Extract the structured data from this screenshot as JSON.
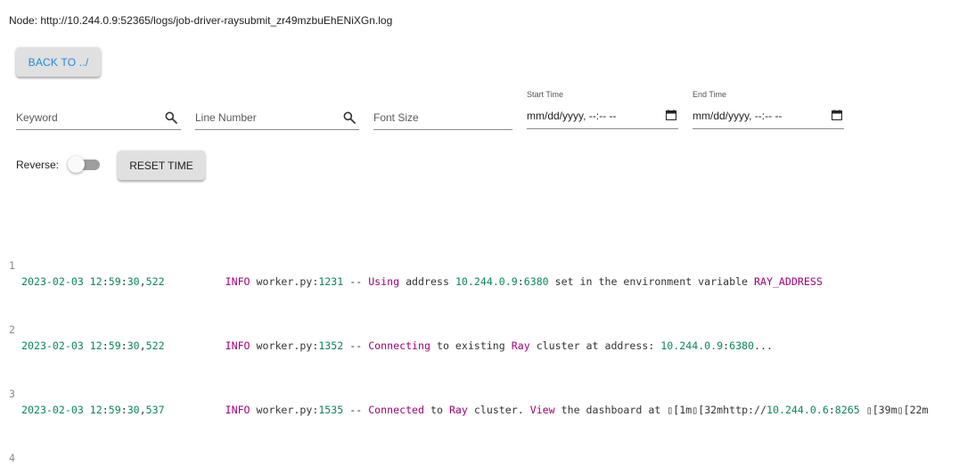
{
  "node": {
    "title": "Node: http://10.244.0.9:52365/logs/job-driver-raysubmit_zr49mzbuEhENiXGn.log"
  },
  "buttons": {
    "back_label": "BACK TO ../",
    "reset_label": "RESET TIME"
  },
  "filters": {
    "keyword_placeholder": "Keyword",
    "line_number_placeholder": "Line Number",
    "font_size_placeholder": "Font Size",
    "start_time_label": "Start Time",
    "start_time_value": "mm/dd/yyyy, --:-- --",
    "end_time_label": "End Time",
    "end_time_value": "mm/dd/yyyy, --:-- --"
  },
  "reverse": {
    "label": "Reverse:",
    "checked": false
  },
  "log": {
    "lines": [
      {
        "n": "1",
        "date": "2023-02-03",
        "t1": "12",
        "t2": "59",
        "t3": "30",
        "ms": "522",
        "level": "INFO",
        "file": "worker.py",
        "lineno": "1231",
        "sep": "--",
        "verb": "Using",
        "mid": "address",
        "ip": "10.244.0.9",
        "port": "6380",
        "rest": "set in the environment variable",
        "tail": "RAY_ADDRESS"
      },
      {
        "n": "2",
        "date": "2023-02-03",
        "t1": "12",
        "t2": "59",
        "t3": "30",
        "ms": "522",
        "level": "INFO",
        "file": "worker.py",
        "lineno": "1352",
        "sep": "--",
        "verb": "Connecting",
        "mid": "to existing",
        "ray": "Ray",
        "rest": "cluster at address:",
        "ip": "10.244.0.9",
        "port": "6380",
        "tail": "..."
      },
      {
        "n": "3",
        "date": "2023-02-03",
        "t1": "12",
        "t2": "59",
        "t3": "30",
        "ms": "537",
        "level": "INFO",
        "file": "worker.py",
        "lineno": "1535",
        "sep": "--",
        "verb": "Connected",
        "mid": "to",
        "ray": "Ray",
        "rest": "cluster.",
        "view": "View",
        "rest2": "the dashboard at ",
        "esc1": "[1m",
        "esc2": "[32mhttp://",
        "ip": "10.244.0.6",
        "port": "8265",
        "esc3": "[39m",
        "esc4": "[22m"
      },
      {
        "n": "4"
      }
    ]
  }
}
